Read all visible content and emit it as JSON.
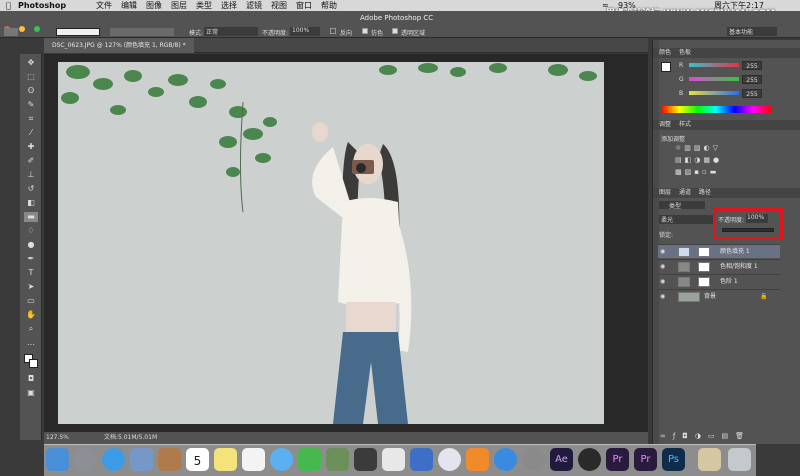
{
  "menubar": {
    "app": "Photoshop",
    "menus": [
      "文件",
      "编辑",
      "图像",
      "图层",
      "类型",
      "选择",
      "滤镜",
      "视图",
      "窗口",
      "帮助"
    ],
    "battery": "93%",
    "clock": "周六下午2:17",
    "watermark": "思缘设计论坛 WWW.MISSYUAN.COM"
  },
  "options": {
    "title": "Adobe Photoshop CC",
    "mode_label": "模式:",
    "mode_value": "正常",
    "opacity_label": "不透明度:",
    "opacity_value": "100%",
    "reverse_label": "反向",
    "dither_label": "仿色",
    "transparency_label": "透明区域",
    "workspace": "基本功能"
  },
  "document": {
    "tab": "DSC_0623.JPG @ 127% (颜色填充 1, RGB/8) *"
  },
  "status": {
    "zoom": "127.5%",
    "doc": "文档:5.01M/5.01M"
  },
  "color_panel": {
    "tab1": "颜色",
    "tab2": "色板",
    "channels": [
      {
        "label": "R",
        "value": "255",
        "color": "#e0334a"
      },
      {
        "label": "G",
        "value": "255",
        "color": "#37c63a"
      },
      {
        "label": "B",
        "value": "255",
        "color": "#2d6df0"
      }
    ]
  },
  "adjust_panel": {
    "tab1": "调整",
    "tab2": "样式",
    "add_label": "添加调整"
  },
  "layers_panel": {
    "tab1": "图层",
    "tab2": "通道",
    "tab3": "路径",
    "filter_label": "类型",
    "blend_value": "柔光",
    "opacity_label": "不透明度:",
    "opacity_value": "100%",
    "lock_label": "锁定:",
    "layers": [
      "颜色填充 1",
      "色相/饱和度 1",
      "色阶 1",
      "背景"
    ]
  },
  "dock": {
    "calendar_day": "5",
    "ae_label": "Ae",
    "pr_label": "Pr",
    "ps_label": "Ps"
  },
  "colors": {
    "accent": "#e0141b",
    "panel": "#535353",
    "dark": "#282828"
  }
}
